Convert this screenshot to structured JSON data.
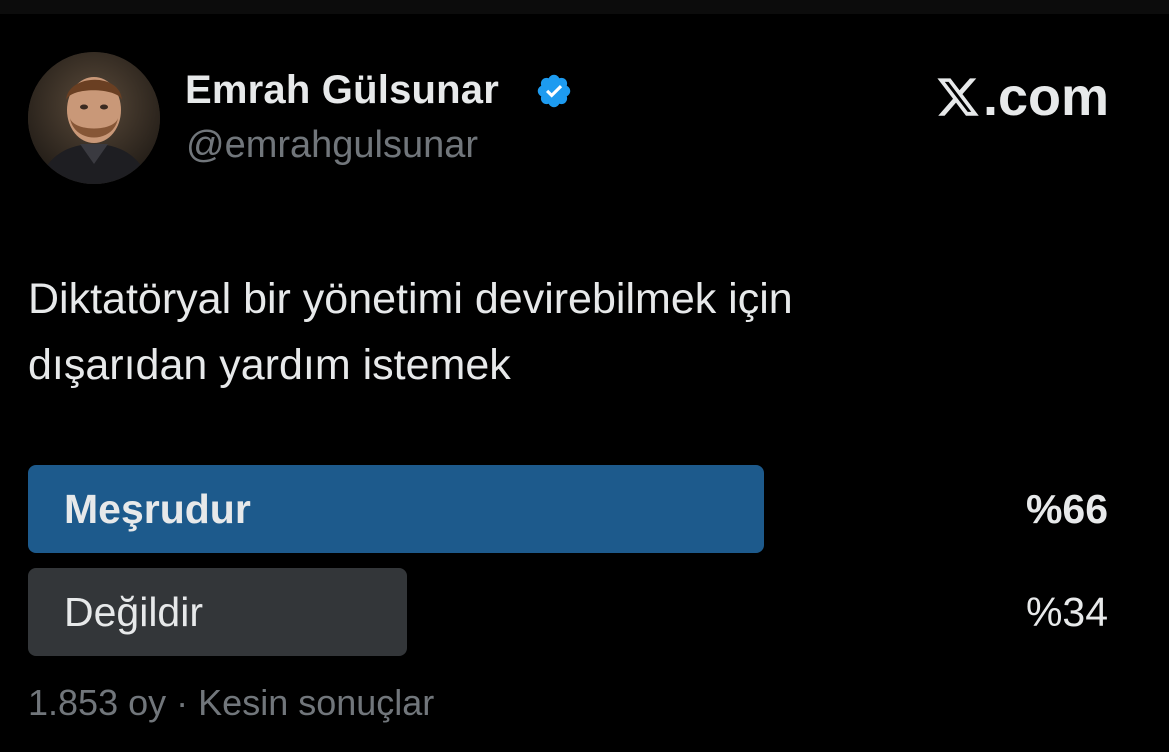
{
  "author": {
    "display_name": "Emrah Gülsunar",
    "handle": "@emrahgulsunar",
    "verified": true,
    "avatar_icon": "profile-photo"
  },
  "brand": {
    "suffix": ".com",
    "icon": "x-logo-icon"
  },
  "tweet": {
    "line1": "Diktatöryal bir yönetimi devirebilmek için",
    "line2": "dışarıdan yardım istemek"
  },
  "poll": {
    "options": [
      {
        "label": "Meşrudur",
        "percent_text": "%66",
        "percent": 66,
        "winner": true,
        "bar_color": "#1d5a8c"
      },
      {
        "label": "Değildir",
        "percent_text": "%34",
        "percent": 34,
        "winner": false,
        "bar_color": "#333639"
      }
    ],
    "votes": "1.853 oy",
    "separator": "·",
    "status": "Kesin sonuçlar"
  },
  "colors": {
    "background": "#000000",
    "text_primary": "#e7e9ea",
    "text_secondary": "#71767b",
    "verified_blue": "#1d9bf0"
  }
}
